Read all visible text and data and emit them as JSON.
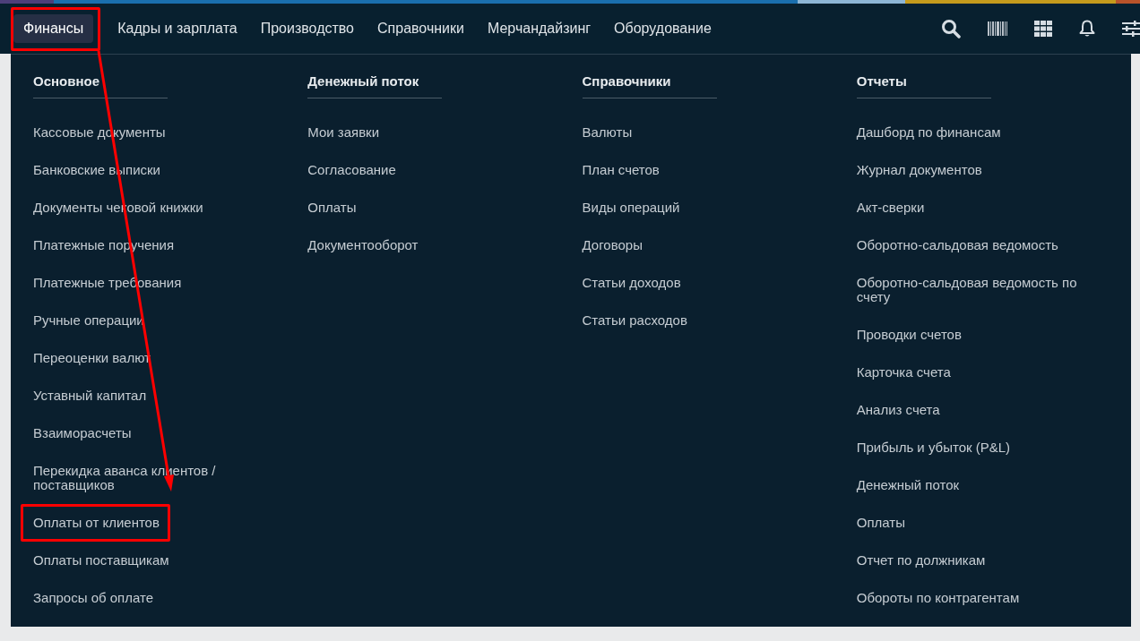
{
  "nav": {
    "tabs": [
      {
        "label": "Финансы",
        "selected": true,
        "highlighted": true
      },
      {
        "label": "Кадры и зарплата",
        "selected": false,
        "highlighted": false
      },
      {
        "label": "Производство",
        "selected": false,
        "highlighted": false
      },
      {
        "label": "Справочники",
        "selected": false,
        "highlighted": false
      },
      {
        "label": "Мерчандайзинг",
        "selected": false,
        "highlighted": false
      },
      {
        "label": "Оборудование",
        "selected": false,
        "highlighted": false
      }
    ]
  },
  "menu": {
    "columns": [
      {
        "heading": "Основное",
        "items": [
          {
            "label": "Кассовые документы",
            "highlighted": false
          },
          {
            "label": "Банковские выписки",
            "highlighted": false
          },
          {
            "label": "Документы чековой книжки",
            "highlighted": false
          },
          {
            "label": "Платежные поручения",
            "highlighted": false
          },
          {
            "label": "Платежные требования",
            "highlighted": false
          },
          {
            "label": "Ручные операции",
            "highlighted": false
          },
          {
            "label": "Переоценки валют",
            "highlighted": false
          },
          {
            "label": "Уставный капитал",
            "highlighted": false
          },
          {
            "label": "Взаиморасчеты",
            "highlighted": false
          },
          {
            "label": "Перекидка аванса клиентов / поставщиков",
            "highlighted": false
          },
          {
            "label": "Оплаты от клиентов",
            "highlighted": true
          },
          {
            "label": "Оплаты поставщикам",
            "highlighted": false
          },
          {
            "label": "Запросы об оплате",
            "highlighted": false
          }
        ]
      },
      {
        "heading": "Денежный поток",
        "items": [
          {
            "label": "Мои заявки",
            "highlighted": false
          },
          {
            "label": "Согласование",
            "highlighted": false
          },
          {
            "label": "Оплаты",
            "highlighted": false
          },
          {
            "label": "Документооборот",
            "highlighted": false
          }
        ]
      },
      {
        "heading": "Справочники",
        "items": [
          {
            "label": "Валюты",
            "highlighted": false
          },
          {
            "label": "План счетов",
            "highlighted": false
          },
          {
            "label": "Виды операций",
            "highlighted": false
          },
          {
            "label": "Договоры",
            "highlighted": false
          },
          {
            "label": "Статьи доходов",
            "highlighted": false
          },
          {
            "label": "Статьи расходов",
            "highlighted": false
          }
        ]
      },
      {
        "heading": "Отчеты",
        "items": [
          {
            "label": "Дашборд по финансам",
            "highlighted": false
          },
          {
            "label": "Журнал документов",
            "highlighted": false
          },
          {
            "label": "Акт-сверки",
            "highlighted": false
          },
          {
            "label": "Оборотно-сальдовая ведомость",
            "highlighted": false
          },
          {
            "label": "Оборотно-сальдовая ведомость по счету",
            "highlighted": false
          },
          {
            "label": "Проводки счетов",
            "highlighted": false
          },
          {
            "label": "Карточка счета",
            "highlighted": false
          },
          {
            "label": "Анализ счета",
            "highlighted": false
          },
          {
            "label": "Прибыль и убыток (P&L)",
            "highlighted": false
          },
          {
            "label": "Денежный поток",
            "highlighted": false
          },
          {
            "label": "Оплаты",
            "highlighted": false
          },
          {
            "label": "Отчет по должникам",
            "highlighted": false
          },
          {
            "label": "Обороты по контрагентам",
            "highlighted": false
          }
        ]
      }
    ]
  }
}
